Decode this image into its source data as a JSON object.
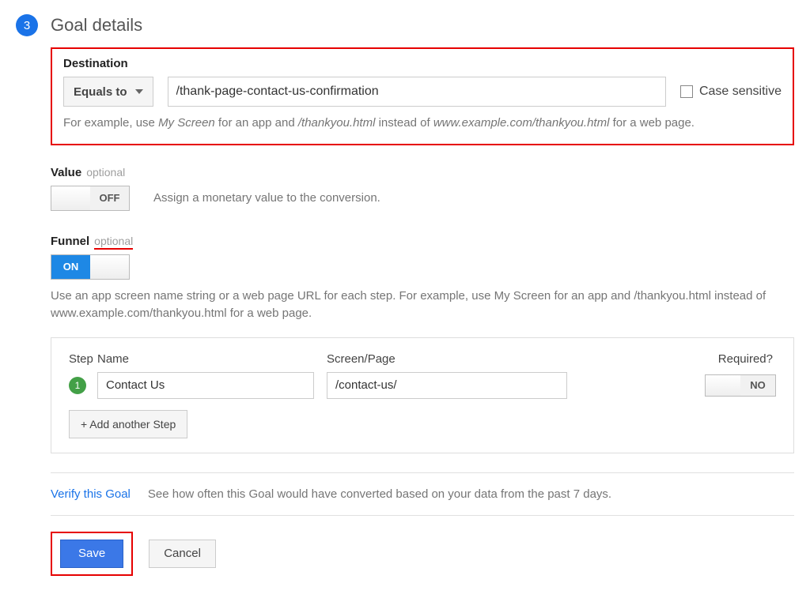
{
  "step": {
    "number": "3",
    "title": "Goal details"
  },
  "destination": {
    "label": "Destination",
    "match_type": "Equals to",
    "value": "/thank-page-contact-us-confirmation",
    "case_sensitive_label": "Case sensitive",
    "help_prefix": "For example, use ",
    "help_app": "My Screen",
    "help_mid": " for an app and ",
    "help_path": "/thankyou.html",
    "help_mid2": " instead of ",
    "help_url": "www.example.com/thankyou.html",
    "help_suffix": " for a web page."
  },
  "value": {
    "label": "Value",
    "optional": "optional",
    "toggle": "OFF",
    "desc": "Assign a monetary value to the conversion."
  },
  "funnel": {
    "label": "Funnel",
    "optional": "optional",
    "toggle": "ON",
    "help_prefix": "Use an app screen name string or a web page URL for each step. For example, use ",
    "help_app": "My Screen",
    "help_mid": " for an app and ",
    "help_path": "/thankyou.html",
    "help_mid2": " instead of ",
    "help_url": "www.example.com/thankyou.html",
    "help_suffix": " for a web page.",
    "cols": {
      "step": "Step",
      "name": "Name",
      "screen": "Screen/Page",
      "required": "Required?"
    },
    "steps": [
      {
        "num": "1",
        "name": "Contact Us",
        "screen": "/contact-us/",
        "required": "NO"
      }
    ],
    "add_step": "+ Add another Step"
  },
  "verify": {
    "link": "Verify this Goal",
    "desc": "See how often this Goal would have converted based on your data from the past 7 days."
  },
  "actions": {
    "save": "Save",
    "cancel": "Cancel"
  }
}
